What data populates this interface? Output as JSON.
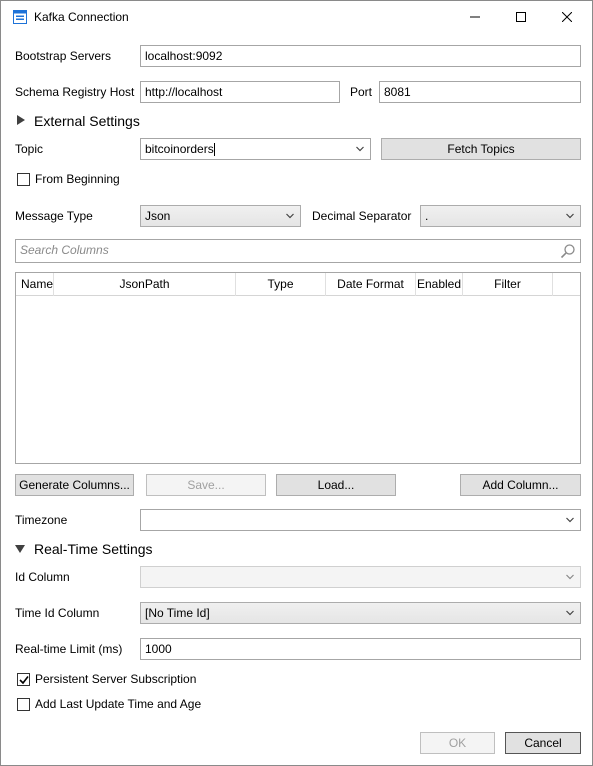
{
  "window": {
    "title": "Kafka Connection"
  },
  "bootstrap": {
    "label": "Bootstrap Servers",
    "value": "localhost:9092"
  },
  "schema": {
    "label": "Schema Registry Host",
    "value": "http://localhost",
    "port_label": "Port",
    "port_value": "8081"
  },
  "external": {
    "title": "External Settings"
  },
  "topic": {
    "label": "Topic",
    "value": "bitcoinorders",
    "fetch_label": "Fetch Topics"
  },
  "from_beginning": {
    "label": "From Beginning",
    "checked": false
  },
  "message": {
    "label": "Message Type",
    "value": "Json",
    "decimal_label": "Decimal Separator",
    "decimal_value": "."
  },
  "search": {
    "placeholder": "Search Columns"
  },
  "grid": {
    "columns": [
      "Name",
      "JsonPath",
      "Type",
      "Date Format",
      "Enabled",
      "Filter"
    ]
  },
  "buttons": {
    "generate": "Generate Columns...",
    "save": "Save...",
    "load": "Load...",
    "add_column": "Add Column..."
  },
  "timezone": {
    "label": "Timezone",
    "value": ""
  },
  "realtime": {
    "title": "Real-Time Settings",
    "id_column_label": "Id Column",
    "id_column_value": "",
    "time_id_label": "Time Id Column",
    "time_id_value": "[No Time Id]",
    "limit_label": "Real-time Limit (ms)",
    "limit_value": "1000"
  },
  "persistent": {
    "label": "Persistent Server Subscription",
    "checked": true
  },
  "add_last_update": {
    "label": "Add Last Update Time and Age",
    "checked": false
  },
  "footer": {
    "ok": "OK",
    "cancel": "Cancel"
  },
  "colors": {
    "accent": "#0078d7",
    "button_face": "#e1e1e1",
    "border": "#a6a6a6"
  }
}
